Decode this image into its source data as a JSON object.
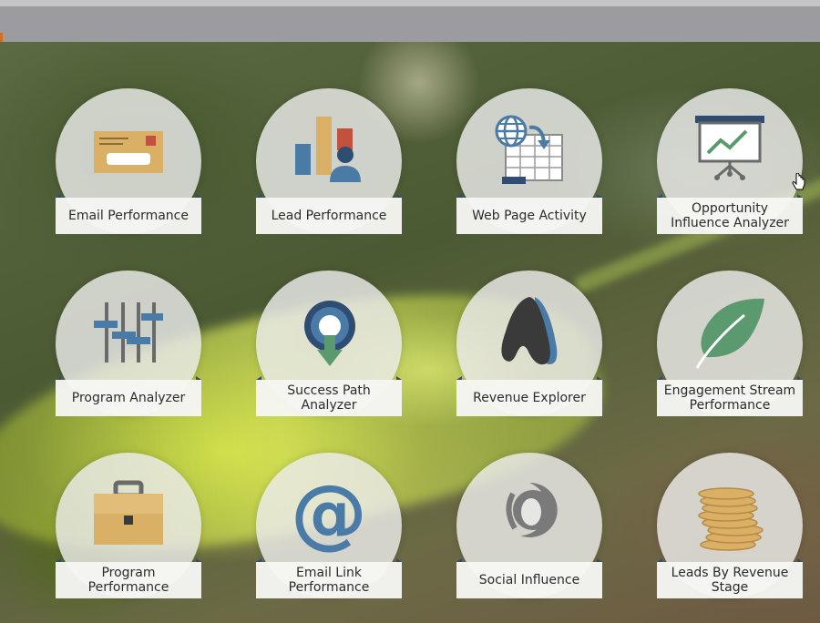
{
  "tiles": [
    {
      "label": "Email Performance",
      "icon": "envelope-icon"
    },
    {
      "label": "Lead Performance",
      "icon": "bar-chart-person-icon"
    },
    {
      "label": "Web Page Activity",
      "icon": "globe-spreadsheet-icon"
    },
    {
      "label": "Opportunity\nInfluence Analyzer",
      "icon": "presentation-board-icon"
    },
    {
      "label": "Program Analyzer",
      "icon": "sliders-icon"
    },
    {
      "label": "Success Path\nAnalyzer",
      "icon": "path-download-icon"
    },
    {
      "label": "Revenue Explorer",
      "icon": "revenue-explorer-icon"
    },
    {
      "label": "Engagement Stream\nPerformance",
      "icon": "leaf-icon"
    },
    {
      "label": "Program\nPerformance",
      "icon": "briefcase-icon"
    },
    {
      "label": "Email Link\nPerformance",
      "icon": "at-sign-icon"
    },
    {
      "label": "Social Influence",
      "icon": "social-influence-icon"
    },
    {
      "label": "Leads By Revenue\nStage",
      "icon": "coin-stack-icon"
    }
  ],
  "colors": {
    "navy": "#2f4c72",
    "blue": "#4a7ba6",
    "gold": "#d9b066",
    "red": "#c0523e",
    "green": "#5a9a6e",
    "gray": "#6a6a6a"
  }
}
